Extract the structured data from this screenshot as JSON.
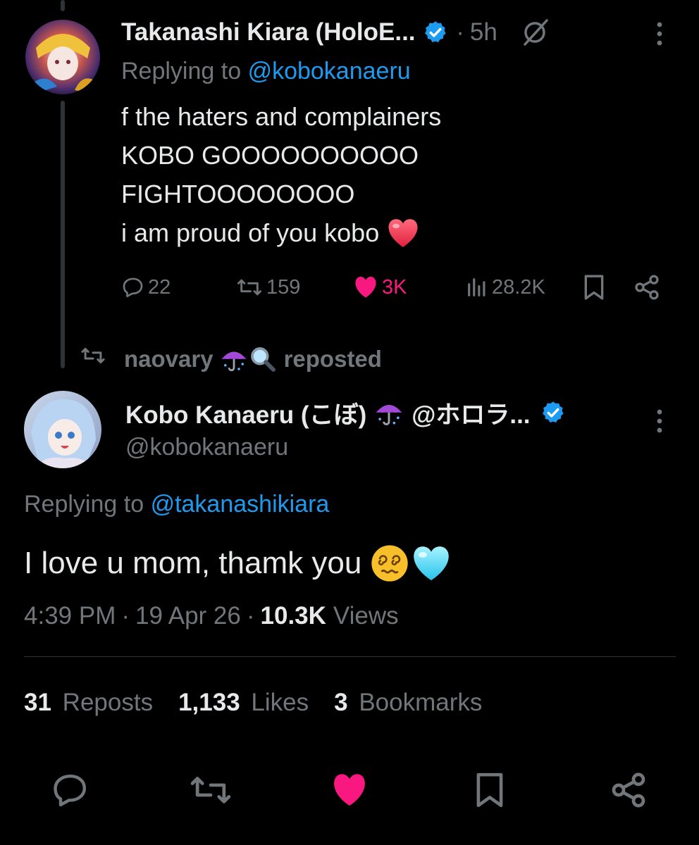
{
  "parent_tweet": {
    "display_name": "Takanashi Kiara (HoloE...",
    "time_separator": "·",
    "time": "5h",
    "replying_prefix": "Replying to",
    "replying_handle": "@kobokanaeru",
    "lines": [
      "f the haters and complainers",
      "KOBO GOOOOOOOOOO",
      "FIGHTOOOOOOOO",
      "i am proud of you kobo"
    ],
    "metrics": {
      "replies": "22",
      "reposts": "159",
      "likes": "3K",
      "views": "28.2K"
    }
  },
  "repost_banner": {
    "reposter": "naovary",
    "suffix": "reposted"
  },
  "main_tweet": {
    "display_name": "Kobo Kanaeru (こぼ)",
    "name_suffix": "@ホロラ...",
    "handle": "@kobokanaeru",
    "replying_prefix": "Replying to",
    "replying_handle": "@takanashikiara",
    "text": "I love u mom, thamk you",
    "timestamp": {
      "time": "4:39 PM",
      "sep1": "·",
      "date": "19 Apr 26",
      "sep2": "·",
      "views_count": "10.3K",
      "views_label": "Views"
    },
    "engagement": {
      "reposts_count": "31",
      "reposts_label": "Reposts",
      "likes_count": "1,133",
      "likes_label": "Likes",
      "bookmarks_count": "3",
      "bookmarks_label": "Bookmarks"
    }
  },
  "colors": {
    "background": "#000000",
    "text": "#e7e9ea",
    "muted": "#71767b",
    "link": "#1d9bf0",
    "like": "#f91880",
    "divider": "#2f3336"
  }
}
